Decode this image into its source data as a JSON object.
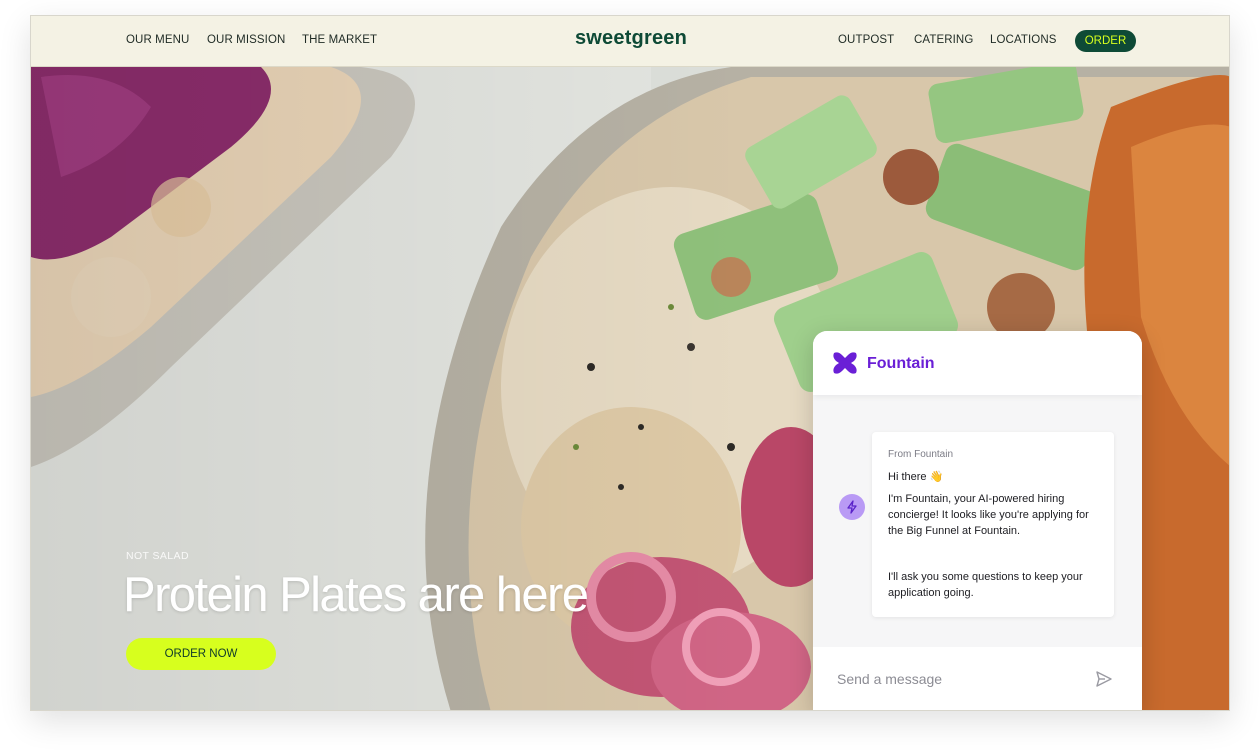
{
  "nav": {
    "left_links": [
      "OUR MENU",
      "OUR MISSION",
      "THE MARKET"
    ],
    "logo": "sweetgreen",
    "right_links": [
      "OUTPOST",
      "CATERING",
      "LOCATIONS"
    ],
    "order_label": "ORDER"
  },
  "hero": {
    "eyebrow": "NOT SALAD",
    "headline": "Protein Plates are here",
    "cta_label": "ORDER NOW"
  },
  "chat": {
    "brand": "Fountain",
    "from_label": "From Fountain",
    "greeting": "Hi there 👋",
    "message": "I'm Fountain, your AI-powered hiring concierge! It looks like you're applying for the Big Funnel at Fountain.",
    "message2": "I'll ask you some questions to keep your application going.",
    "input_placeholder": "Send a message",
    "icons": {
      "logo": "fountain-logo-icon",
      "avatar": "lightning-bolt-icon",
      "send": "send-arrow-icon"
    }
  },
  "colors": {
    "nav_bg": "#f4f2e4",
    "brand_green": "#0e4a36",
    "accent_lime": "#d7ff1e",
    "fountain_purple": "#6a1fd6",
    "avatar_purple": "#b99af5"
  }
}
